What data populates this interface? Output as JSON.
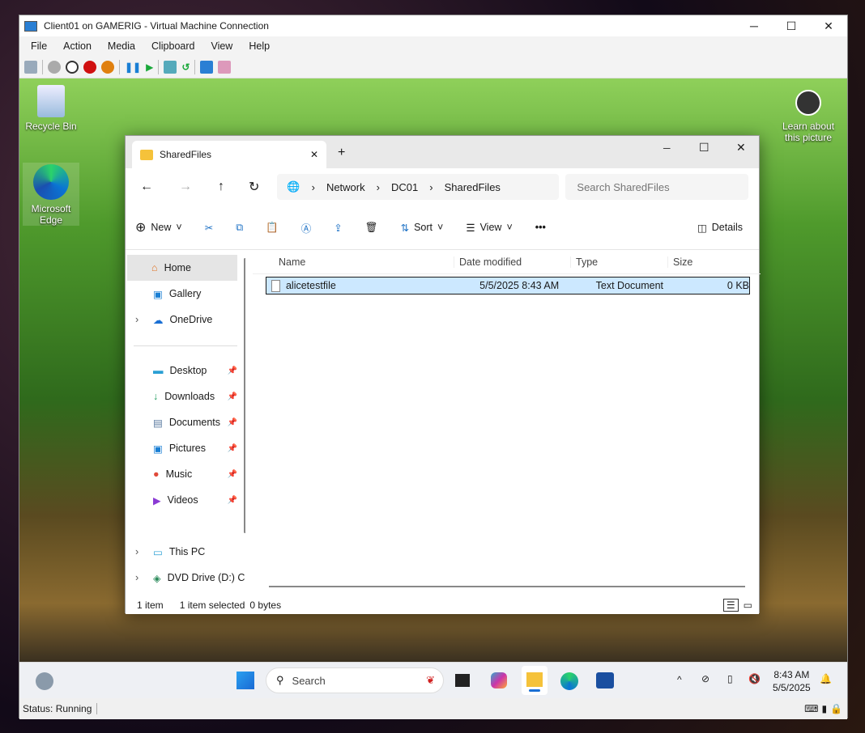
{
  "vm": {
    "title": "Client01 on GAMERIG - Virtual Machine Connection",
    "menu": [
      "File",
      "Action",
      "Media",
      "Clipboard",
      "View",
      "Help"
    ],
    "status": "Status: Running"
  },
  "desktop": {
    "recycle_bin": "Recycle Bin",
    "edge": "Microsoft Edge",
    "learn": "Learn about this picture"
  },
  "explorer": {
    "tab_title": "SharedFiles",
    "breadcrumb": [
      "Network",
      "DC01",
      "SharedFiles"
    ],
    "search_placeholder": "Search SharedFiles",
    "commands": {
      "new": "New",
      "sort": "Sort",
      "view": "View",
      "more": "•••",
      "details": "Details"
    },
    "nav": {
      "home": "Home",
      "gallery": "Gallery",
      "onedrive": "OneDrive",
      "desktop": "Desktop",
      "downloads": "Downloads",
      "documents": "Documents",
      "pictures": "Pictures",
      "music": "Music",
      "videos": "Videos",
      "thispc": "This PC",
      "dvd": "DVD Drive (D:) C"
    },
    "columns": [
      "Name",
      "Date modified",
      "Type",
      "Size"
    ],
    "files": [
      {
        "name": "alicetestfile",
        "date": "5/5/2025 8:43 AM",
        "type": "Text Document",
        "size": "0 KB"
      }
    ],
    "status": {
      "count": "1 item",
      "selected": "1 item selected",
      "bytes": "0 bytes"
    }
  },
  "taskbar": {
    "search": "Search",
    "time": "8:43 AM",
    "date": "5/5/2025"
  }
}
